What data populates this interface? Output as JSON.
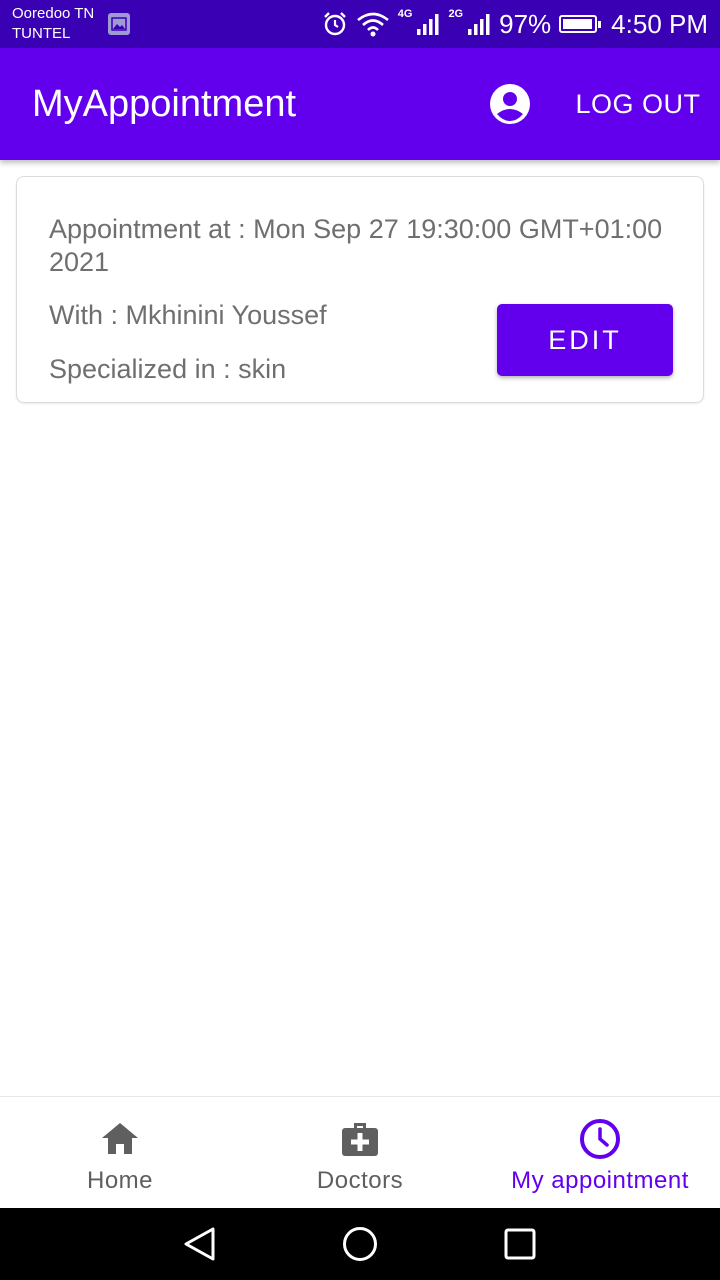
{
  "status_bar": {
    "carrier_line1": "Ooredoo TN",
    "carrier_line2": "TUNTEL",
    "network1": "4G",
    "network2": "2G",
    "battery_percent": "97%",
    "battery_level": 0.97,
    "time": "4:50 PM"
  },
  "app_bar": {
    "title": "MyAppointment",
    "account_icon": "account-circle-icon",
    "logout_label": "LOG OUT"
  },
  "appointment": {
    "datetime_text": "Appointment at : Mon Sep 27 19:30:00 GMT+01:00 2021",
    "with_text": "With : Mkhinini Youssef",
    "specialty_text": "Specialized in : skin",
    "edit_label": "EDIT"
  },
  "bottom_nav": {
    "items": [
      {
        "label": "Home",
        "icon": "home-icon"
      },
      {
        "label": "Doctors",
        "icon": "medical-bag-icon"
      },
      {
        "label": "My appointment",
        "icon": "clock-icon",
        "active": true
      }
    ]
  },
  "colors": {
    "primary": "#6200ee",
    "status_bar": "#3a00b4",
    "text_secondary": "#6f6f6f",
    "nav_inactive": "#5f5f5f"
  }
}
